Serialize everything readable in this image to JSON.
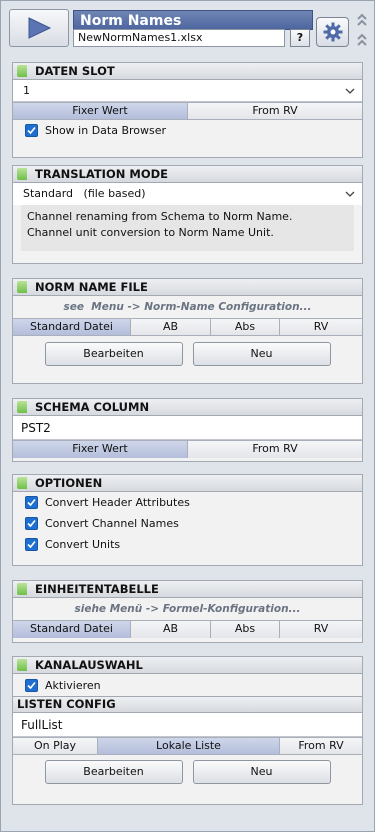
{
  "header": {
    "title": "Norm Names",
    "filename": "NewNormNames1.xlsx",
    "help_label": "?"
  },
  "daten_slot": {
    "title": "DATEN SLOT",
    "value": "1",
    "seg": [
      "Fixer Wert",
      "From RV"
    ],
    "show_browser": "Show in Data Browser"
  },
  "translation": {
    "title": "TRANSLATION MODE",
    "value": "Standard   (file based)",
    "desc1": "Channel renaming from Schema to Norm Name.",
    "desc2": "Channel unit conversion to Norm Name Unit."
  },
  "norm_file": {
    "title": "NORM NAME FILE",
    "hint": "see  Menu -> Norm-Name Configuration...",
    "seg": [
      "Standard Datei",
      "AB",
      "Abs",
      "RV"
    ],
    "btn_edit": "Bearbeiten",
    "btn_new": "Neu"
  },
  "schema": {
    "title": "SCHEMA COLUMN",
    "value": "PST2",
    "seg": [
      "Fixer Wert",
      "From RV"
    ]
  },
  "optionen": {
    "title": "OPTIONEN",
    "items": [
      "Convert Header Attributes",
      "Convert Channel Names",
      "Convert Units"
    ]
  },
  "einheiten": {
    "title": "EINHEITENTABELLE",
    "hint": "siehe Menü -> Formel-Konfiguration...",
    "seg": [
      "Standard Datei",
      "AB",
      "Abs",
      "RV"
    ]
  },
  "kanal": {
    "title": "KANALAUSWAHL",
    "aktivieren": "Aktivieren",
    "listen_title": "LISTEN CONFIG",
    "value": "FullList",
    "seg": [
      "On Play",
      "Lokale Liste",
      "From RV"
    ],
    "btn_edit": "Bearbeiten",
    "btn_new": "Neu"
  }
}
